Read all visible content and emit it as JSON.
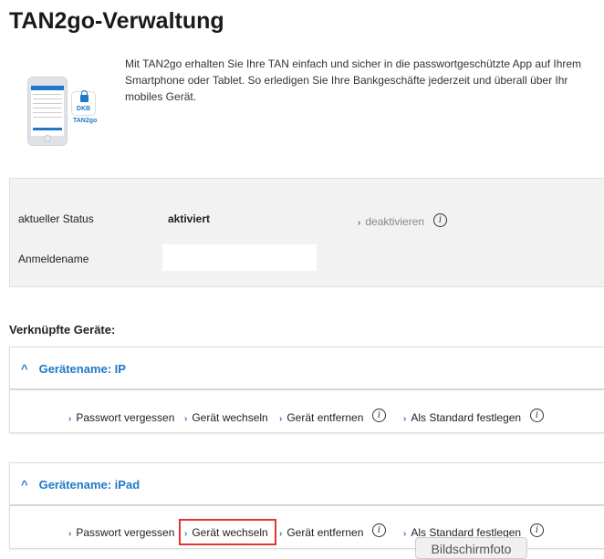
{
  "page_title": "TAN2go-Verwaltung",
  "description": "Mit TAN2go erhalten Sie Ihre TAN einfach und sicher in die passwortgeschützte App auf Ihrem Smartphone oder Tablet. So erledigen Sie Ihre Bankgeschäfte jederzeit und überall über Ihr mobiles Gerät.",
  "app_logo": {
    "brand": "DKB",
    "name": "TAN2go"
  },
  "status": {
    "label": "aktueller Status",
    "value": "aktiviert",
    "deactivate_link": "deaktivieren",
    "username_label": "Anmeldename",
    "username_value": ""
  },
  "devices_heading": "Verknüpfte Geräte:",
  "devices": [
    {
      "name": "Gerätename: IP",
      "actions": {
        "forgot": "Passwort vergessen",
        "change": "Gerät wechseln",
        "remove": "Gerät entfernen",
        "default": "Als Standard festlegen"
      }
    },
    {
      "name": "Gerätename: iPad",
      "actions": {
        "forgot": "Passwort vergessen",
        "change": "Gerät wechseln",
        "remove": "Gerät entfernen",
        "default": "Als Standard festlegen"
      }
    }
  ],
  "icons": {
    "chevron": "›",
    "caret_up": "^",
    "info": "i"
  },
  "tooltip": "Bildschirmfoto",
  "colors": {
    "accent": "#1f78c8",
    "highlight": "#e8322e",
    "panel": "#f2f2f2"
  }
}
